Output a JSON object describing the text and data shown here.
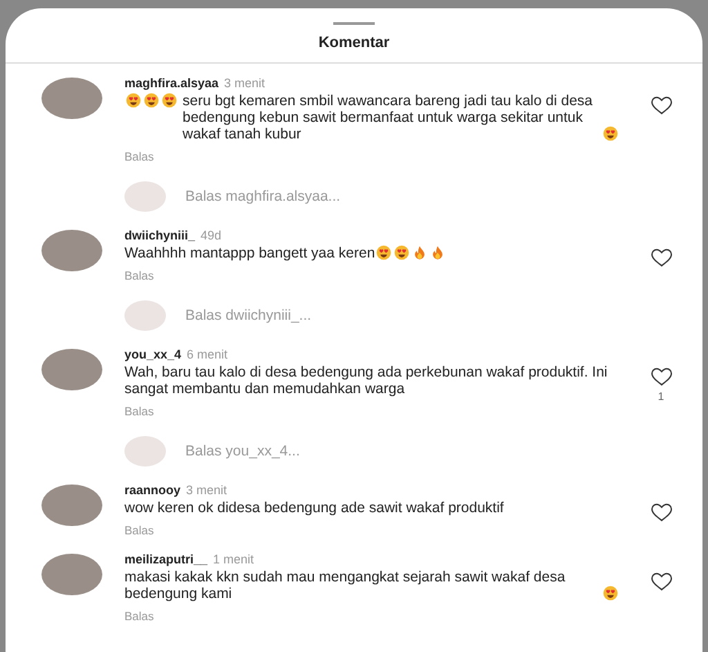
{
  "sheet": {
    "title": "Komentar"
  },
  "items": [
    {
      "kind": "comment",
      "username": "maghfira.alsyaa",
      "time": "3 menit",
      "body": [
        {
          "kind": "heart_eyes_emoji"
        },
        {
          "kind": "heart_eyes_emoji"
        },
        {
          "kind": "heart_eyes_emoji"
        },
        {
          "kind": "text",
          "text": "seru bgt kemaren smbil wawancara bareng jadi tau kalo di desa bedengung kebun sawit bermanfaat untuk warga sekitar untuk wakaf tanah kubur"
        },
        {
          "kind": "heart_eyes_emoji"
        }
      ],
      "reply": "Balas"
    },
    {
      "kind": "reply_prompt",
      "placeholder": "Balas maghfira.alsyaa..."
    },
    {
      "kind": "comment",
      "username": "dwiichyniii_",
      "time": "49d",
      "body": [
        {
          "kind": "text",
          "text": "Waahhhh mantappp bangett yaa keren"
        },
        {
          "kind": "heart_eyes_emoji"
        },
        {
          "kind": "heart_eyes_emoji"
        },
        {
          "kind": "fire_emoji"
        },
        {
          "kind": "fire_emoji"
        }
      ],
      "reply": "Balas"
    },
    {
      "kind": "reply_prompt",
      "placeholder": "Balas dwiichyniii_..."
    },
    {
      "kind": "comment",
      "username": "you_xx_4",
      "time": "6 menit",
      "body": [
        {
          "kind": "text",
          "text": "Wah, baru tau kalo di desa bedengung ada perkebunan wakaf produktif. Ini sangat membantu dan memudahkan warga"
        }
      ],
      "reply": "Balas",
      "likes": "1"
    },
    {
      "kind": "reply_prompt",
      "placeholder": "Balas you_xx_4..."
    },
    {
      "kind": "comment",
      "username": "raannooy",
      "time": "3 menit",
      "body": [
        {
          "kind": "text",
          "text": "wow keren ok didesa bedengung ade sawit wakaf produktif"
        }
      ],
      "reply": "Balas"
    },
    {
      "kind": "comment",
      "username": "meilizaputri__",
      "time": "1 menit",
      "body": [
        {
          "kind": "text",
          "text": "makasi kakak kkn sudah mau mengangkat sejarah sawit wakaf desa bedengung kami"
        },
        {
          "kind": "heart_eyes_emoji"
        }
      ],
      "reply": "Balas"
    }
  ]
}
